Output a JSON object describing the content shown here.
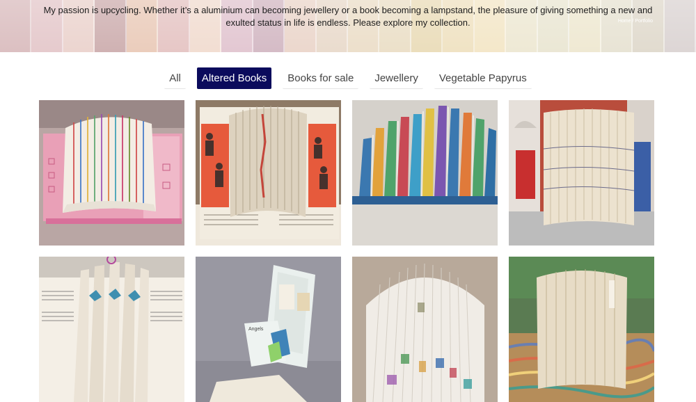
{
  "hero": {
    "intro": "My passion is upcycling.  Whether it’s a aluminium can becoming jewellery or a book becoming a lampstand, the pleasure of giving something a new and exulted status in life is endless. Please explore my collection.",
    "breadcrumb": "Home / Portfolio",
    "stripe_colors": [
      "#d7b7b9",
      "#e2c3c6",
      "#e9cfc9",
      "#c9a7a8",
      "#e8c6b3",
      "#e3bfbe",
      "#f0d9cc",
      "#dfc0cc",
      "#cfb2be",
      "#e9d2c6",
      "#e7d7c7",
      "#eadbc4",
      "#e9dcc2",
      "#e8d9b3",
      "#eedfbc",
      "#f2e4c2",
      "#ece6cf",
      "#e8e4cf",
      "#ede6cd",
      "#e5e0cf",
      "#ddd6c8",
      "#d8d0cf"
    ]
  },
  "filters": {
    "items": [
      {
        "label": "All",
        "active": false
      },
      {
        "label": "Altered Books",
        "active": true
      },
      {
        "label": "Books for sale",
        "active": false
      },
      {
        "label": "Jewellery",
        "active": false
      },
      {
        "label": "Vegetable Papyrus",
        "active": false
      }
    ],
    "active_color": "#0b0b5c"
  },
  "gallery": {
    "items": [
      {
        "name": "altered-book-pink-rainbow-pages"
      },
      {
        "name": "altered-book-red-illustrated-pages"
      },
      {
        "name": "altered-book-marbled-fan"
      },
      {
        "name": "altered-book-red-door-cylinder"
      },
      {
        "name": "altered-book-sheet-music"
      },
      {
        "name": "altered-book-pop-up-card"
      },
      {
        "name": "altered-book-colorful-folds"
      },
      {
        "name": "altered-book-marbled-base"
      }
    ]
  }
}
